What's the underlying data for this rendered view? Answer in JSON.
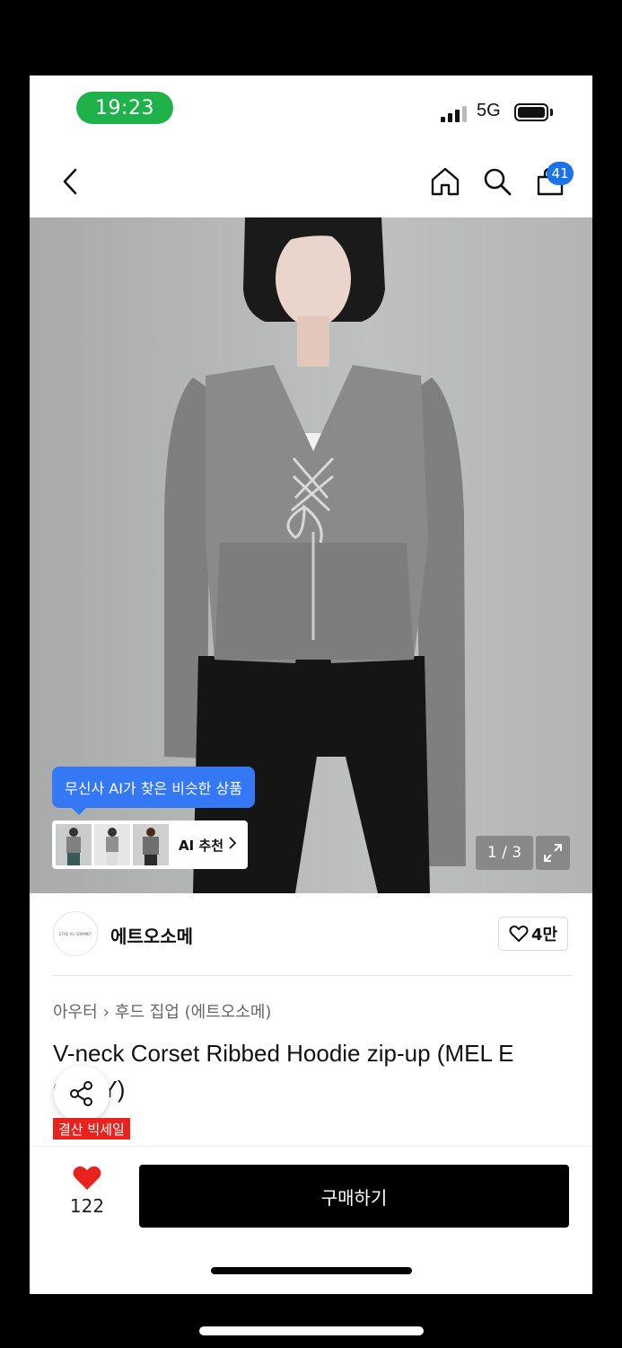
{
  "status_bar": {
    "time": "19:23",
    "network": "5G"
  },
  "nav": {
    "cart_count": "41"
  },
  "hero": {
    "ai_tooltip": "무신사 AI가 찾은 비슷한 상품",
    "ai_recommend_label": "AI 추천",
    "page_counter": "1 / 3"
  },
  "brand": {
    "name": "에트오소메",
    "logo_text": "ETRE AU SOMMET",
    "likes": "4만"
  },
  "product": {
    "breadcrumb": [
      "아우터",
      "후드 집업 (에트오소메)"
    ],
    "title": "V-neck Corset Ribbed Hoodie zip-up (MEL  E GRAY)",
    "sale_badge": "결산 빅세일"
  },
  "bottom_bar": {
    "heart_count": "122",
    "buy_label": "구매하기"
  },
  "colors": {
    "accent_blue": "#3478f6",
    "badge_blue": "#1a73e8",
    "status_green": "#1fb14a",
    "sale_red": "#e8231d",
    "heart_red": "#e8231d"
  }
}
